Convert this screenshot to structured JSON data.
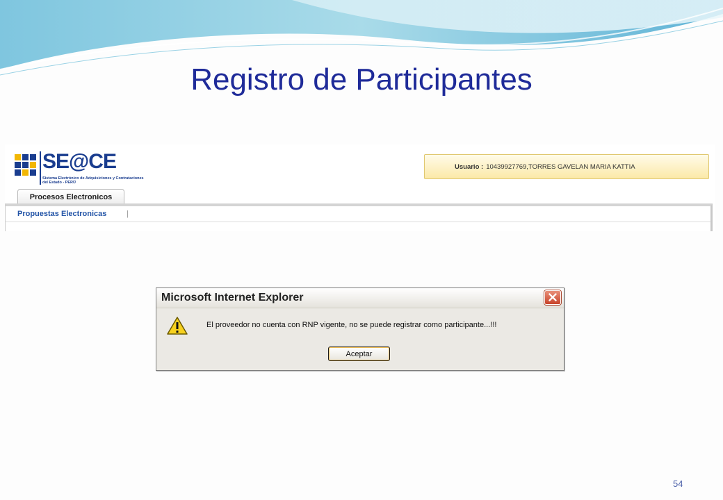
{
  "slide": {
    "title": "Registro de Participantes",
    "page_number": "54"
  },
  "app": {
    "logo": {
      "text": "SE@CE",
      "subtitle": "Sistema Electrónico de Adquisiciones y Contrataciones del Estado - PERÚ"
    },
    "user": {
      "label": "Usuario :",
      "value": "10439927769,TORRES GAVELAN MARIA KATTIA"
    },
    "tab": {
      "label": "Procesos Electronicos"
    },
    "subnav": {
      "item": "Propuestas Electronicas",
      "separator": "|"
    }
  },
  "dialog": {
    "title": "Microsoft Internet Explorer",
    "message": "El proveedor no cuenta con RNP vigente, no se puede registrar como participante...!!!",
    "button": "Aceptar",
    "icon": "warning-icon"
  },
  "colors": {
    "title": "#1f2b99",
    "brand": "#1a3d8f",
    "link": "#2455a7"
  }
}
